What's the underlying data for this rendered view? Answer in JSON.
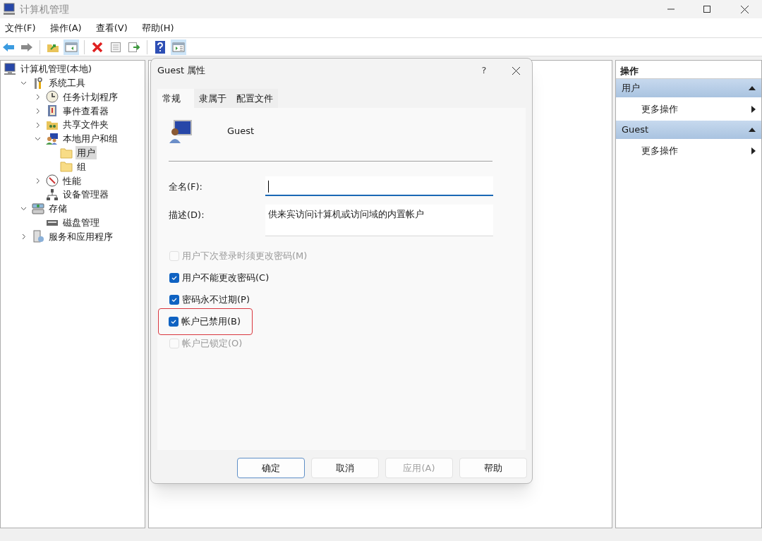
{
  "window": {
    "title": "计算机管理"
  },
  "menu": [
    "文件(F)",
    "操作(A)",
    "查看(V)",
    "帮助(H)"
  ],
  "toolbar": [
    {
      "kind": "back",
      "pressed": false
    },
    {
      "kind": "forward",
      "pressed": false
    },
    {
      "kind": "sep"
    },
    {
      "kind": "up",
      "pressed": false
    },
    {
      "kind": "panel",
      "pressed": true
    },
    {
      "kind": "sep"
    },
    {
      "kind": "delete",
      "pressed": false
    },
    {
      "kind": "props",
      "pressed": false
    },
    {
      "kind": "export",
      "pressed": false
    },
    {
      "kind": "sep"
    },
    {
      "kind": "help",
      "pressed": false
    },
    {
      "kind": "panel2",
      "pressed": true
    }
  ],
  "tree": [
    {
      "label": "计算机管理(本地)",
      "kind": "computer",
      "selected": false,
      "children": [
        {
          "label": "系统工具",
          "kind": "tools",
          "expanded": true,
          "selected": false,
          "children": [
            {
              "label": "任务计划程序",
              "kind": "clock",
              "expanded": false,
              "selected": false
            },
            {
              "label": "事件查看器",
              "kind": "log",
              "expanded": false,
              "selected": false
            },
            {
              "label": "共享文件夹",
              "kind": "share",
              "expanded": false,
              "selected": false
            },
            {
              "label": "本地用户和组",
              "kind": "users",
              "expanded": true,
              "selected": false,
              "children": [
                {
                  "label": "用户",
                  "kind": "folder",
                  "selected": true
                },
                {
                  "label": "组",
                  "kind": "folder",
                  "selected": false
                }
              ]
            },
            {
              "label": "性能",
              "kind": "perf",
              "expanded": false,
              "selected": false
            },
            {
              "label": "设备管理器",
              "kind": "device",
              "selected": false
            }
          ]
        },
        {
          "label": "存储",
          "kind": "storage",
          "expanded": true,
          "selected": false,
          "children": [
            {
              "label": "磁盘管理",
              "kind": "disk",
              "selected": false
            }
          ]
        },
        {
          "label": "服务和应用程序",
          "kind": "services",
          "expanded": false,
          "selected": false
        }
      ]
    }
  ],
  "actions": {
    "title": "操作",
    "sections": [
      {
        "title": "用户",
        "expanded": true,
        "items": [
          "更多操作"
        ]
      },
      {
        "title": "Guest",
        "expanded": true,
        "items": [
          "更多操作"
        ]
      }
    ]
  },
  "dialog": {
    "title": "Guest 属性",
    "help": "?",
    "tabs": [
      {
        "label": "常规",
        "selected": true
      },
      {
        "label": "隶属于",
        "selected": false
      },
      {
        "label": "配置文件",
        "selected": false
      }
    ],
    "user_name": "Guest",
    "fields": [
      {
        "label": "全名(F):",
        "focused": true
      },
      {
        "label": "描述(D):",
        "value": "供来宾访问计算机或访问域的内置帐户",
        "focused": false
      }
    ],
    "checkboxes": [
      {
        "label": "用户下次登录时须更改密码(M)",
        "checked": false,
        "disabled": true,
        "highlighted": false
      },
      {
        "label": "用户不能更改密码(C)",
        "checked": true,
        "disabled": false,
        "highlighted": false
      },
      {
        "label": "密码永不过期(P)",
        "checked": true,
        "disabled": false,
        "highlighted": false
      },
      {
        "label": "帐户已禁用(B)",
        "checked": true,
        "disabled": false,
        "highlighted": true
      },
      {
        "label": "帐户已锁定(O)",
        "checked": false,
        "disabled": true,
        "highlighted": false
      }
    ],
    "buttons": [
      {
        "label": "确定",
        "default": true,
        "disabled": false
      },
      {
        "label": "取消",
        "default": false,
        "disabled": false
      },
      {
        "label": "应用(A)",
        "default": false,
        "disabled": true
      },
      {
        "label": "帮助",
        "default": false,
        "disabled": false
      }
    ]
  }
}
